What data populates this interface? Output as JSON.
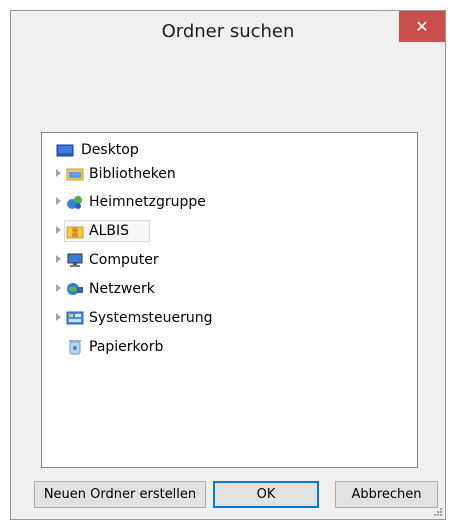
{
  "window": {
    "title": "Ordner suchen",
    "close_label": "✕"
  },
  "tree": {
    "items": [
      {
        "label": "Desktop",
        "icon": "desktop-icon",
        "expandable": false
      },
      {
        "label": "Bibliotheken",
        "icon": "libraries-icon",
        "expandable": true
      },
      {
        "label": "Heimnetzgruppe",
        "icon": "homegroup-icon",
        "expandable": true
      },
      {
        "label": "ALBIS",
        "icon": "user-folder-icon",
        "expandable": true,
        "selected": true
      },
      {
        "label": "Computer",
        "icon": "computer-icon",
        "expandable": true
      },
      {
        "label": "Netzwerk",
        "icon": "network-icon",
        "expandable": true
      },
      {
        "label": "Systemsteuerung",
        "icon": "control-panel-icon",
        "expandable": true
      },
      {
        "label": "Papierkorb",
        "icon": "recycle-bin-icon",
        "expandable": false
      }
    ]
  },
  "buttons": {
    "new_folder": "Neuen Ordner erstellen",
    "ok": "OK",
    "cancel": "Abbrechen"
  },
  "colors": {
    "close_button": "#c7504c",
    "default_button_border": "#0078d7"
  }
}
